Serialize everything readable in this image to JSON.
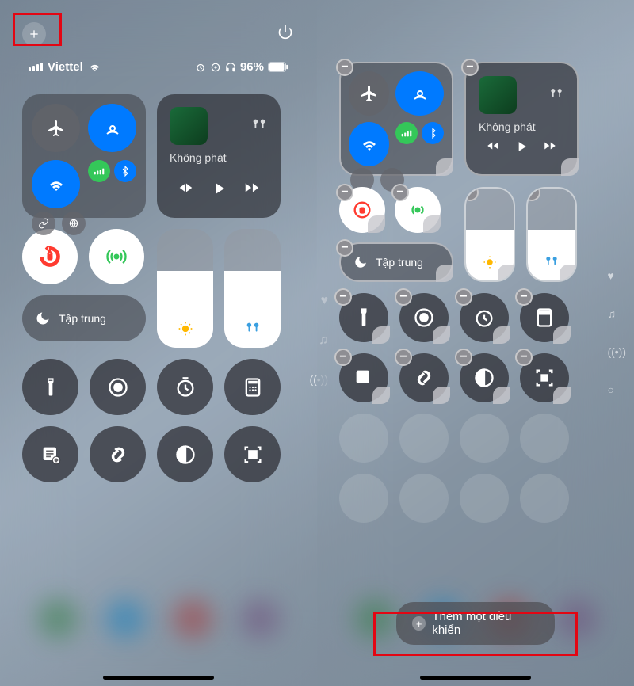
{
  "left": {
    "carrier": "Viettel",
    "battery": "96%",
    "focus_label": "Tập trung",
    "media_label": "Không phát"
  },
  "right": {
    "focus_label": "Tập trung",
    "media_label": "Không phát",
    "add_control_label": "Thêm một điều khiển"
  }
}
